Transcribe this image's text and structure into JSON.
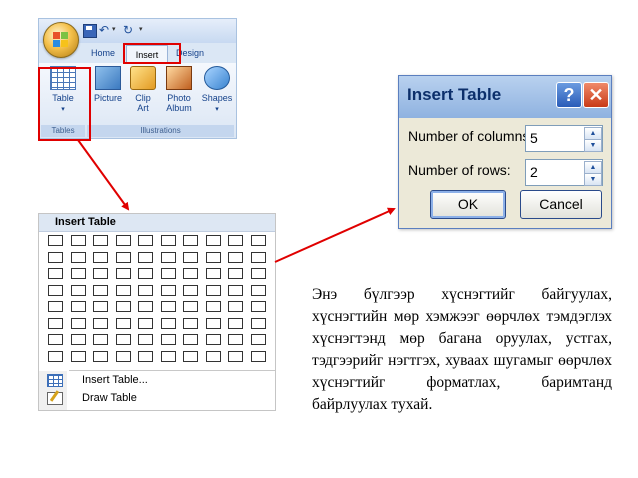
{
  "ribbon": {
    "tabs": {
      "home": "Home",
      "insert": "Insert",
      "design": "Design"
    },
    "buttons": {
      "table": "Table",
      "picture": "Picture",
      "clip_art": "Clip Art",
      "photo_album": "Photo Album",
      "shapes": "Shapes"
    },
    "groups": {
      "tables": "Tables",
      "illustrations": "Illustrations"
    }
  },
  "menu": {
    "header": "Insert Table",
    "grid_columns": 10,
    "grid_rows": 8,
    "items": [
      "Insert Table...",
      "Draw Table"
    ]
  },
  "dialog": {
    "title": "Insert Table",
    "columns_label": "Number of columns:",
    "columns_value": "5",
    "rows_label": "Number of rows:",
    "rows_value": "2",
    "ok_label": "OK",
    "cancel_label": "Cancel"
  },
  "description": "Энэ бүлгээр хүснэгтийг байгуулах, хүснэгтийн мөр хэмжээг өөрчлөх тэмдэглэх хүснэгтэнд мөр багана оруулах, устгах, тэдгээрийг нэгтгэх, хуваах шугамыг өөрчлөх хүснэгтийг форматлах, баримтанд байрлуулах тухай.",
  "colors": {
    "highlight": "#e00000",
    "ribbon": "#dbe7f5",
    "dialog_title": "#0c2f6b"
  }
}
